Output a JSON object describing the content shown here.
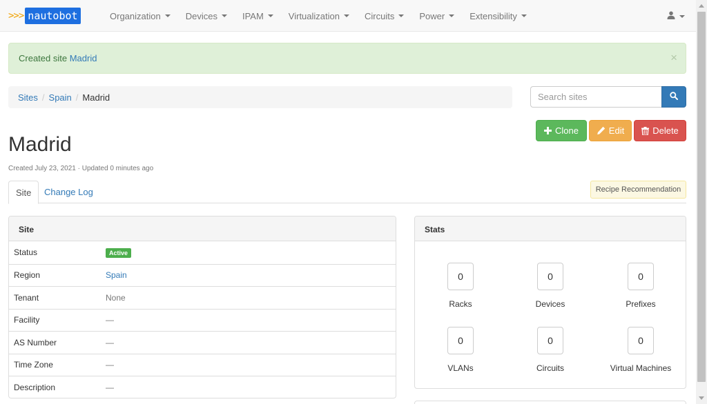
{
  "nav": {
    "brand_text": "nautobot",
    "brand_arrows": ">>>",
    "items": [
      "Organization",
      "Devices",
      "IPAM",
      "Virtualization",
      "Circuits",
      "Power",
      "Extensibility"
    ]
  },
  "alert": {
    "prefix": "Created site",
    "link": "Madrid",
    "close": "×"
  },
  "breadcrumb": {
    "items": [
      "Sites",
      "Spain"
    ],
    "current": "Madrid",
    "separator": "/"
  },
  "search": {
    "placeholder": "Search sites"
  },
  "actions": {
    "clone": "Clone",
    "edit": "Edit",
    "delete": "Delete"
  },
  "page": {
    "title": "Madrid",
    "meta": "Created July 23, 2021 · Updated 0 minutes ago"
  },
  "tabs": {
    "site": "Site",
    "changelog": "Change Log",
    "recipe": "Recipe Recommendation"
  },
  "site_panel": {
    "heading": "Site",
    "rows": [
      {
        "label": "Status",
        "value": "Active"
      },
      {
        "label": "Region",
        "value": "Spain"
      },
      {
        "label": "Tenant",
        "value": "None"
      },
      {
        "label": "Facility",
        "value": "—"
      },
      {
        "label": "AS Number",
        "value": "—"
      },
      {
        "label": "Time Zone",
        "value": "—"
      },
      {
        "label": "Description",
        "value": "—"
      }
    ]
  },
  "stats_panel": {
    "heading": "Stats",
    "items": [
      {
        "label": "Racks",
        "value": "0"
      },
      {
        "label": "Devices",
        "value": "0"
      },
      {
        "label": "Prefixes",
        "value": "0"
      },
      {
        "label": "VLANs",
        "value": "0"
      },
      {
        "label": "Circuits",
        "value": "0"
      },
      {
        "label": "Virtual Machines",
        "value": "0"
      }
    ]
  },
  "colors": {
    "primary": "#337ab7",
    "success": "#5cb85c",
    "warning": "#f0ad4e",
    "danger": "#d9534f",
    "alert_bg": "#dff0d8",
    "brand": "#1e6fe0"
  }
}
